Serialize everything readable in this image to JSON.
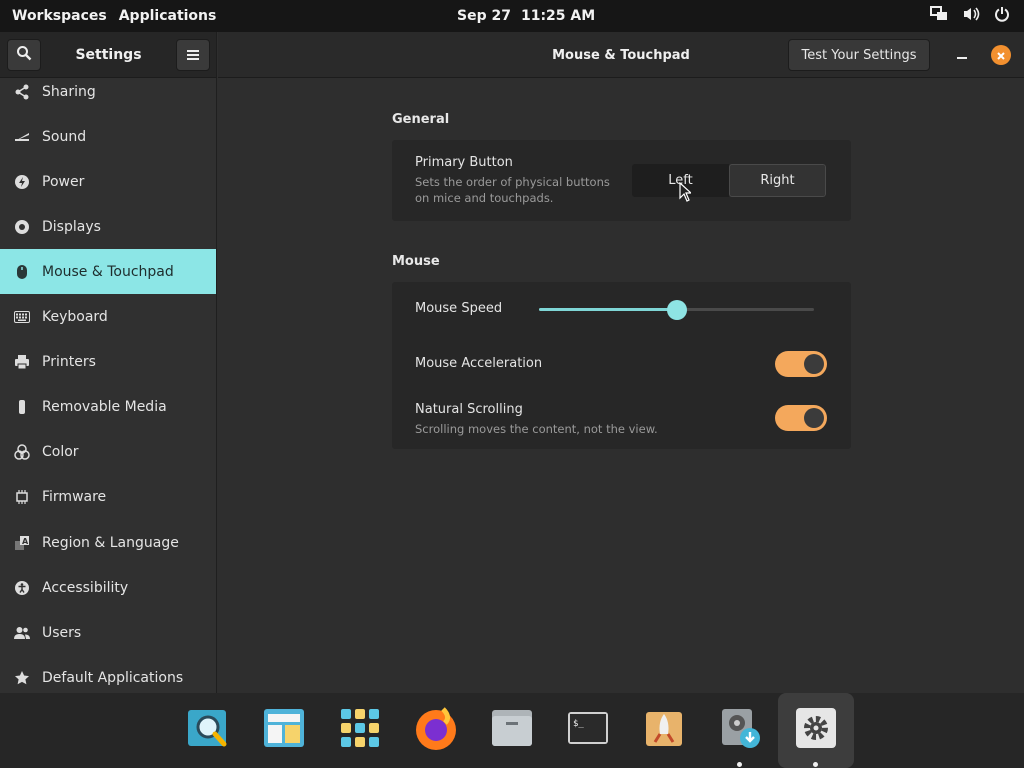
{
  "topbar": {
    "workspaces": "Workspaces",
    "applications": "Applications",
    "date": "Sep 27",
    "time": "11:25 AM"
  },
  "window": {
    "sidebar_title": "Settings",
    "title": "Mouse & Touchpad",
    "test_button": "Test Your Settings"
  },
  "sidebar": {
    "items": [
      {
        "label": "Sharing",
        "icon": "share-icon"
      },
      {
        "label": "Sound",
        "icon": "sound-icon"
      },
      {
        "label": "Power",
        "icon": "power-icon"
      },
      {
        "label": "Displays",
        "icon": "display-icon"
      },
      {
        "label": "Mouse & Touchpad",
        "icon": "mouse-icon",
        "active": true
      },
      {
        "label": "Keyboard",
        "icon": "keyboard-icon"
      },
      {
        "label": "Printers",
        "icon": "printer-icon"
      },
      {
        "label": "Removable Media",
        "icon": "usb-icon"
      },
      {
        "label": "Color",
        "icon": "color-icon"
      },
      {
        "label": "Firmware",
        "icon": "chip-icon"
      },
      {
        "label": "Region & Language",
        "icon": "language-icon"
      },
      {
        "label": "Accessibility",
        "icon": "accessibility-icon"
      },
      {
        "label": "Users",
        "icon": "users-icon"
      },
      {
        "label": "Default Applications",
        "icon": "star-icon"
      }
    ]
  },
  "general": {
    "title": "General",
    "primary_button": {
      "label": "Primary Button",
      "description_line1": "Sets the order of physical buttons",
      "description_line2": "on mice and touchpads.",
      "options": [
        "Left",
        "Right"
      ],
      "selected": "Left"
    }
  },
  "mouse": {
    "title": "Mouse",
    "speed": {
      "label": "Mouse Speed",
      "value": 0.5
    },
    "acceleration": {
      "label": "Mouse Acceleration",
      "enabled": true
    },
    "natural_scrolling": {
      "label": "Natural Scrolling",
      "description": "Scrolling moves the content, not the view.",
      "enabled": true
    }
  },
  "dock": {
    "items": [
      {
        "name": "search-app",
        "running": false
      },
      {
        "name": "mail-app",
        "running": false
      },
      {
        "name": "app-grid",
        "running": false
      },
      {
        "name": "firefox",
        "running": false
      },
      {
        "name": "files",
        "running": false
      },
      {
        "name": "terminal",
        "running": false
      },
      {
        "name": "appcenter",
        "running": false
      },
      {
        "name": "installer",
        "running": true
      },
      {
        "name": "settings",
        "running": true
      }
    ]
  },
  "colors": {
    "accent": "#8ce6e6",
    "toggle_on": "#f4a85c",
    "close": "#f2902f"
  }
}
